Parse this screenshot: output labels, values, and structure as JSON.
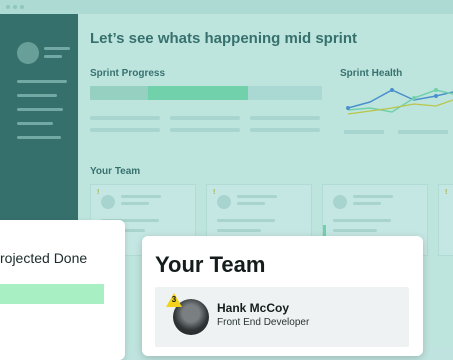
{
  "dashboard": {
    "title": "Let’s see whats happening mid sprint",
    "sprint_progress_label": "Sprint Progress",
    "sprint_progress_value": 0.68,
    "sprint_health_label": "Sprint Health",
    "team_label": "Your Team"
  },
  "projected_card": {
    "label": "rojected Done"
  },
  "team_card": {
    "title": "Your Team",
    "member": {
      "rank": "3",
      "name": "Hank McCoy",
      "role": "Front End Developer"
    }
  },
  "colors": {
    "sidebar": "#0e3b3b",
    "accent_green": "#6cd7a0",
    "line_blue": "#2f6fd6"
  }
}
